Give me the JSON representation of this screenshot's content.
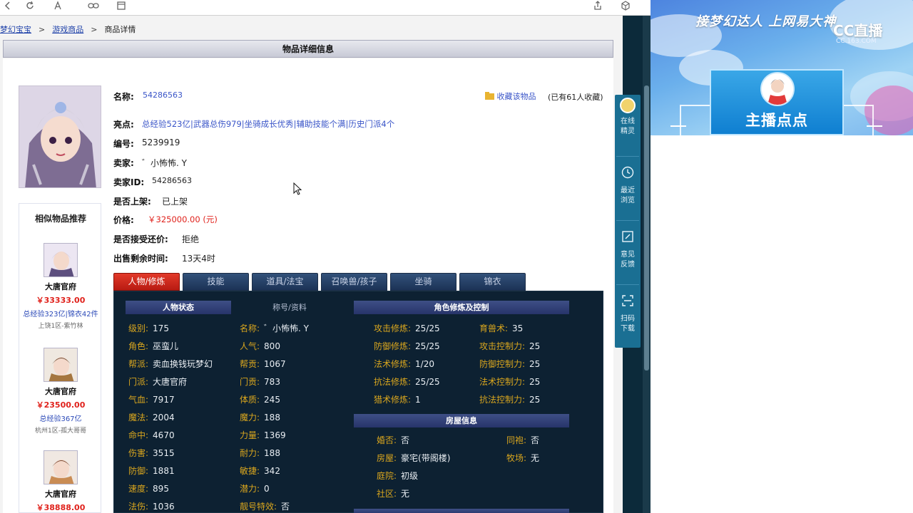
{
  "toolbar": {
    "icons": [
      "refresh-icon",
      "font-icon",
      "link-icon",
      "bookmark-icon",
      "share-icon",
      "extension-icon"
    ]
  },
  "breadcrumb": {
    "home": "梦幻宝宝",
    "category": "游戏商品",
    "current": "商品详情"
  },
  "panel": {
    "title": "物品详细信息"
  },
  "item": {
    "name_label": "名称:",
    "name_value": "54286563",
    "highlights_label": "亮点:",
    "highlights_value": "总经验523亿|武器总伤979|坐骑成长优秀|辅助技能个满|历史门派4个",
    "id_label": "编号:",
    "id_value": "5239919",
    "seller_label": "卖家:",
    "seller_value": "゛小怖怖. Y",
    "seller_id_label": "卖家ID:",
    "seller_id_value": "54286563",
    "listed_label": "是否上架:",
    "listed_value": "已上架",
    "price_label": "价格:",
    "price_value": "￥325000.00 (元)",
    "bargain_label": "是否接受还价:",
    "bargain_value": "拒绝",
    "remaining_label": "出售剩余时间:",
    "remaining_value": "13天4时",
    "favorite_label": "收藏该物品",
    "favorite_count": "(已有61人收藏)"
  },
  "similar": {
    "title": "相似物品推荐",
    "items": [
      {
        "school": "大唐官府",
        "price": "￥33333.00",
        "desc": "总经验323亿|锦衣42件",
        "server": "上饶1区-紫竹林"
      },
      {
        "school": "大唐官府",
        "price": "￥23500.00",
        "desc": "总经验367亿",
        "server": "杭州1区-孤大哥哥"
      },
      {
        "school": "大唐官府",
        "price": "￥38888.00",
        "desc": "",
        "server": ""
      }
    ]
  },
  "tabs": [
    {
      "label": "人物/修炼",
      "active": true
    },
    {
      "label": "技能",
      "active": false
    },
    {
      "label": "道具/法宝",
      "active": false
    },
    {
      "label": "召唤兽/孩子",
      "active": false
    },
    {
      "label": "坐骑",
      "active": false
    },
    {
      "label": "锦衣",
      "active": false
    }
  ],
  "char_status": {
    "head": "人物状态",
    "head2": "称号/资料",
    "left": [
      {
        "k": "级别:",
        "v": "175"
      },
      {
        "k": "角色:",
        "v": "巫蛮儿"
      },
      {
        "k": "帮派:",
        "v": "卖血换钱玩梦幻"
      },
      {
        "k": "门派:",
        "v": "大唐官府"
      },
      {
        "k": "气血:",
        "v": "7917"
      },
      {
        "k": "魔法:",
        "v": "2004"
      },
      {
        "k": "命中:",
        "v": "4670"
      },
      {
        "k": "伤害:",
        "v": "3515"
      },
      {
        "k": "防御:",
        "v": "1881"
      },
      {
        "k": "速度:",
        "v": "895"
      },
      {
        "k": "法伤:",
        "v": "1036"
      }
    ],
    "right": [
      {
        "k": "名称:",
        "v": "゛小怖怖. Y"
      },
      {
        "k": "人气:",
        "v": "800"
      },
      {
        "k": "帮贡:",
        "v": "1067"
      },
      {
        "k": "门贡:",
        "v": "783"
      },
      {
        "k": "体质:",
        "v": "245"
      },
      {
        "k": "魔力:",
        "v": "188"
      },
      {
        "k": "力量:",
        "v": "1369"
      },
      {
        "k": "耐力:",
        "v": "188"
      },
      {
        "k": "敏捷:",
        "v": "342"
      },
      {
        "k": "潜力:",
        "v": "0"
      },
      {
        "k": "靓号特效:",
        "v": "否"
      }
    ]
  },
  "cultivation": {
    "head": "角色修炼及控制",
    "rows": [
      {
        "k1": "攻击修炼:",
        "v1": "25/25",
        "k2": "育兽术:",
        "v2": "35"
      },
      {
        "k1": "防御修炼:",
        "v1": "25/25",
        "k2": "攻击控制力:",
        "v2": "25"
      },
      {
        "k1": "法术修炼:",
        "v1": "1/20",
        "k2": "防御控制力:",
        "v2": "25"
      },
      {
        "k1": "抗法修炼:",
        "v1": "25/25",
        "k2": "法术控制力:",
        "v2": "25"
      },
      {
        "k1": "猎术修炼:",
        "v1": "1",
        "k2": "抗法控制力:",
        "v2": "25"
      }
    ]
  },
  "home_info": {
    "head": "房屋信息",
    "rows": [
      {
        "k1": "婚否:",
        "v1": "否",
        "k2": "同袍:",
        "v2": "否"
      },
      {
        "k1": "房屋:",
        "v1": "豪宅(带阁楼)",
        "k2": "牧场:",
        "v2": "无"
      },
      {
        "k1": "庭院:",
        "v1": "初级",
        "k2": "",
        "v2": ""
      },
      {
        "k1": "社区:",
        "v1": "无",
        "k2": "",
        "v2": ""
      }
    ]
  },
  "float_bar": [
    {
      "label1": "在线",
      "label2": "精灵",
      "icon": "assistant-avatar-icon"
    },
    {
      "label1": "最近",
      "label2": "浏览",
      "icon": "clock-icon"
    },
    {
      "label1": "意见",
      "label2": "反馈",
      "icon": "edit-icon"
    },
    {
      "label1": "扫码",
      "label2": "下载",
      "icon": "scan-icon"
    }
  ],
  "stream": {
    "promo": "接梦幻达人 上网易大神",
    "logo": "CC直播",
    "logo_sub": "CC.163.COM",
    "host_name": "主播点点"
  },
  "colors": {
    "accent_red": "#e0221c",
    "link_blue": "#3a55c8",
    "panel_dark": "#0d2132",
    "label_gold": "#d9a61e",
    "tab_active": "#c52519",
    "float_bar": "#1a6f93"
  }
}
